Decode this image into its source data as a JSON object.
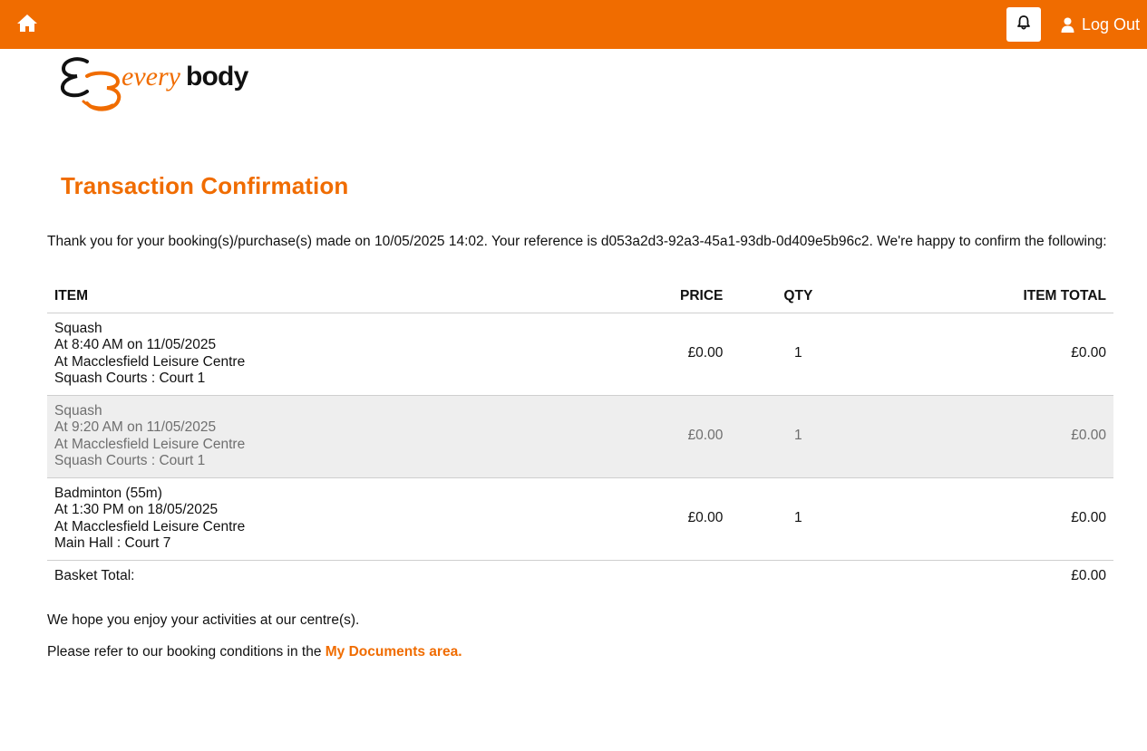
{
  "header": {
    "home_icon": "home-icon",
    "bell_icon": "bell-icon",
    "user_icon": "user-icon",
    "logout_label": "Log Out",
    "brand_color": "#f06c00"
  },
  "logo": {
    "text_every": "every",
    "text_body": "body"
  },
  "page": {
    "title": "Transaction Confirmation",
    "intro": "Thank you for your booking(s)/purchase(s) made on 10/05/2025 14:02. Your reference is d053a2d3-92a3-45a1-93db-0d409e5b96c2. We're happy to confirm the following:"
  },
  "table": {
    "headers": {
      "item": "ITEM",
      "price": "PRICE",
      "qty": "QTY",
      "total": "ITEM TOTAL"
    },
    "rows": [
      {
        "activity": "Squash",
        "time": "At 8:40 AM on 11/05/2025",
        "venue": "At Macclesfield Leisure Centre",
        "location": "Squash Courts : Court 1",
        "price": "£0.00",
        "qty": "1",
        "total": "£0.00"
      },
      {
        "activity": "Squash",
        "time": "At 9:20 AM on 11/05/2025",
        "venue": "At Macclesfield Leisure Centre",
        "location": "Squash Courts : Court 1",
        "price": "£0.00",
        "qty": "1",
        "total": "£0.00"
      },
      {
        "activity": "Badminton (55m)",
        "time": "At 1:30 PM on 18/05/2025",
        "venue": "At Macclesfield Leisure Centre",
        "location": "Main Hall : Court 7",
        "price": "£0.00",
        "qty": "1",
        "total": "£0.00"
      }
    ],
    "basket_label": "Basket Total:",
    "basket_total": "£0.00"
  },
  "footer": {
    "enjoy": "We hope you enjoy your activities at our centre(s).",
    "conditions_prefix": "Please refer to our booking conditions in the ",
    "conditions_link": "My Documents area."
  }
}
